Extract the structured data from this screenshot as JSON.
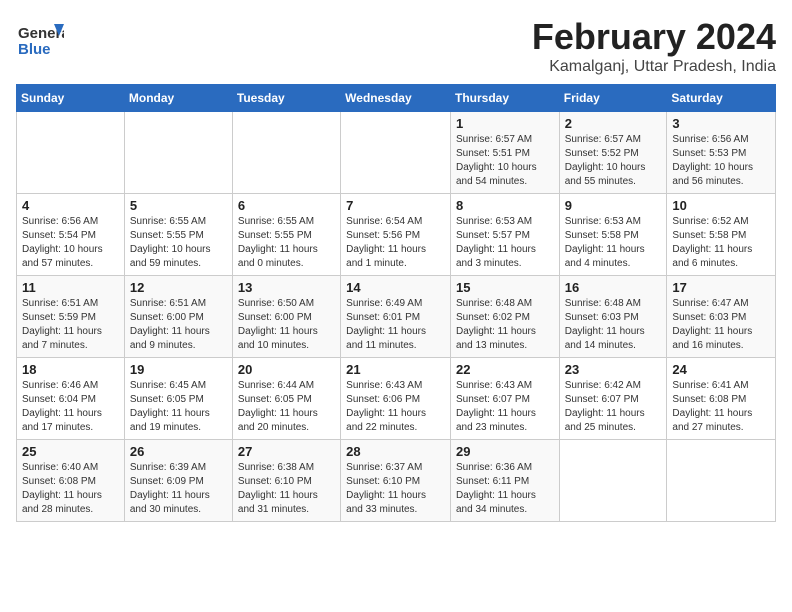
{
  "logo": {
    "line1": "General",
    "line2": "Blue"
  },
  "title": "February 2024",
  "location": "Kamalganj, Uttar Pradesh, India",
  "headers": [
    "Sunday",
    "Monday",
    "Tuesday",
    "Wednesday",
    "Thursday",
    "Friday",
    "Saturday"
  ],
  "weeks": [
    [
      {
        "day": "",
        "info": ""
      },
      {
        "day": "",
        "info": ""
      },
      {
        "day": "",
        "info": ""
      },
      {
        "day": "",
        "info": ""
      },
      {
        "day": "1",
        "info": "Sunrise: 6:57 AM\nSunset: 5:51 PM\nDaylight: 10 hours\nand 54 minutes."
      },
      {
        "day": "2",
        "info": "Sunrise: 6:57 AM\nSunset: 5:52 PM\nDaylight: 10 hours\nand 55 minutes."
      },
      {
        "day": "3",
        "info": "Sunrise: 6:56 AM\nSunset: 5:53 PM\nDaylight: 10 hours\nand 56 minutes."
      }
    ],
    [
      {
        "day": "4",
        "info": "Sunrise: 6:56 AM\nSunset: 5:54 PM\nDaylight: 10 hours\nand 57 minutes."
      },
      {
        "day": "5",
        "info": "Sunrise: 6:55 AM\nSunset: 5:55 PM\nDaylight: 10 hours\nand 59 minutes."
      },
      {
        "day": "6",
        "info": "Sunrise: 6:55 AM\nSunset: 5:55 PM\nDaylight: 11 hours\nand 0 minutes."
      },
      {
        "day": "7",
        "info": "Sunrise: 6:54 AM\nSunset: 5:56 PM\nDaylight: 11 hours\nand 1 minute."
      },
      {
        "day": "8",
        "info": "Sunrise: 6:53 AM\nSunset: 5:57 PM\nDaylight: 11 hours\nand 3 minutes."
      },
      {
        "day": "9",
        "info": "Sunrise: 6:53 AM\nSunset: 5:58 PM\nDaylight: 11 hours\nand 4 minutes."
      },
      {
        "day": "10",
        "info": "Sunrise: 6:52 AM\nSunset: 5:58 PM\nDaylight: 11 hours\nand 6 minutes."
      }
    ],
    [
      {
        "day": "11",
        "info": "Sunrise: 6:51 AM\nSunset: 5:59 PM\nDaylight: 11 hours\nand 7 minutes."
      },
      {
        "day": "12",
        "info": "Sunrise: 6:51 AM\nSunset: 6:00 PM\nDaylight: 11 hours\nand 9 minutes."
      },
      {
        "day": "13",
        "info": "Sunrise: 6:50 AM\nSunset: 6:00 PM\nDaylight: 11 hours\nand 10 minutes."
      },
      {
        "day": "14",
        "info": "Sunrise: 6:49 AM\nSunset: 6:01 PM\nDaylight: 11 hours\nand 11 minutes."
      },
      {
        "day": "15",
        "info": "Sunrise: 6:48 AM\nSunset: 6:02 PM\nDaylight: 11 hours\nand 13 minutes."
      },
      {
        "day": "16",
        "info": "Sunrise: 6:48 AM\nSunset: 6:03 PM\nDaylight: 11 hours\nand 14 minutes."
      },
      {
        "day": "17",
        "info": "Sunrise: 6:47 AM\nSunset: 6:03 PM\nDaylight: 11 hours\nand 16 minutes."
      }
    ],
    [
      {
        "day": "18",
        "info": "Sunrise: 6:46 AM\nSunset: 6:04 PM\nDaylight: 11 hours\nand 17 minutes."
      },
      {
        "day": "19",
        "info": "Sunrise: 6:45 AM\nSunset: 6:05 PM\nDaylight: 11 hours\nand 19 minutes."
      },
      {
        "day": "20",
        "info": "Sunrise: 6:44 AM\nSunset: 6:05 PM\nDaylight: 11 hours\nand 20 minutes."
      },
      {
        "day": "21",
        "info": "Sunrise: 6:43 AM\nSunset: 6:06 PM\nDaylight: 11 hours\nand 22 minutes."
      },
      {
        "day": "22",
        "info": "Sunrise: 6:43 AM\nSunset: 6:07 PM\nDaylight: 11 hours\nand 23 minutes."
      },
      {
        "day": "23",
        "info": "Sunrise: 6:42 AM\nSunset: 6:07 PM\nDaylight: 11 hours\nand 25 minutes."
      },
      {
        "day": "24",
        "info": "Sunrise: 6:41 AM\nSunset: 6:08 PM\nDaylight: 11 hours\nand 27 minutes."
      }
    ],
    [
      {
        "day": "25",
        "info": "Sunrise: 6:40 AM\nSunset: 6:08 PM\nDaylight: 11 hours\nand 28 minutes."
      },
      {
        "day": "26",
        "info": "Sunrise: 6:39 AM\nSunset: 6:09 PM\nDaylight: 11 hours\nand 30 minutes."
      },
      {
        "day": "27",
        "info": "Sunrise: 6:38 AM\nSunset: 6:10 PM\nDaylight: 11 hours\nand 31 minutes."
      },
      {
        "day": "28",
        "info": "Sunrise: 6:37 AM\nSunset: 6:10 PM\nDaylight: 11 hours\nand 33 minutes."
      },
      {
        "day": "29",
        "info": "Sunrise: 6:36 AM\nSunset: 6:11 PM\nDaylight: 11 hours\nand 34 minutes."
      },
      {
        "day": "",
        "info": ""
      },
      {
        "day": "",
        "info": ""
      }
    ]
  ]
}
